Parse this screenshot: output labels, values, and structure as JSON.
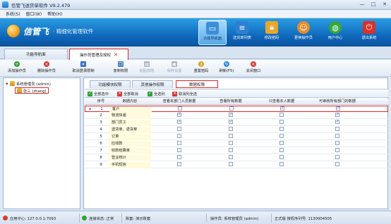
{
  "window": {
    "title": "信管飞送货单软件 V9.2.479",
    "controls": [
      "—",
      "□",
      "✕"
    ]
  },
  "menu": [
    "系统(S)",
    "窗口(W)",
    "帮助(H)"
  ],
  "banner": {
    "brand": "信管飞",
    "slogan": "· 精细化管理软件",
    "nav": [
      {
        "label": "功能导航面",
        "icon": "monitor-icon",
        "color": "#3b8fd9",
        "active": true
      },
      {
        "label": "送货单列表",
        "icon": "list-icon",
        "color": "#2f7fd0",
        "active": false
      },
      {
        "label": "修改密码",
        "icon": "lock-icon",
        "color": "#e9a82b",
        "active": false
      },
      {
        "label": "更换操作员",
        "icon": "user-icon",
        "color": "#e58b2b",
        "active": false
      },
      {
        "label": "用户中心",
        "icon": "globe-icon",
        "color": "#35a83c",
        "active": false
      },
      {
        "label": "退出系统",
        "icon": "power-icon",
        "color": "#d8322b",
        "active": false
      }
    ]
  },
  "pagetabs": [
    {
      "label": "功能导航面",
      "active": false
    },
    {
      "label": "操作员管理及授权",
      "active": true
    }
  ],
  "toolbar": [
    {
      "label": "添加操作员",
      "icon": "add-user-icon",
      "color": "#36a13a",
      "disabled": false
    },
    {
      "label": "删除操作员",
      "icon": "delete-user-icon",
      "color": "#d83a2f",
      "disabled": false
    },
    {
      "label": "取消登录限制",
      "icon": "unlock-icon",
      "color": "#3a6fc9",
      "disabled": false
    },
    {
      "label": "复制权限",
      "icon": "copy-icon",
      "color": "#4c7fc8",
      "disabled": false
    },
    {
      "label": "粘贴权限",
      "icon": "paste-icon",
      "color": "#a9b4c2",
      "disabled": true
    },
    {
      "label": "保存设置",
      "icon": "save-icon",
      "color": "#a9b4c2",
      "disabled": true
    },
    {
      "label": "重置密码",
      "icon": "key-icon",
      "color": "#d9a22a",
      "disabled": false
    },
    {
      "label": "刷新(F5)",
      "icon": "refresh-icon",
      "color": "#2f8ad6",
      "disabled": false
    },
    {
      "label": "关闭窗口",
      "icon": "close-icon",
      "color": "#d83a2f",
      "disabled": false
    }
  ],
  "tree": {
    "root": "系统管理员 (admin)",
    "selected": "张三 (zhang)"
  },
  "subtabs": [
    {
      "label": "功能模块权限",
      "active": false
    },
    {
      "label": "其他操作权限",
      "active": false
    },
    {
      "label": "数据权限",
      "active": true
    }
  ],
  "subbar": [
    {
      "label": "全部选中",
      "icon": "check-all-icon",
      "color": "#2fa33a"
    },
    {
      "label": "全部取消",
      "icon": "uncheck-all-icon",
      "color": "#d83a2f"
    },
    {
      "label": "全选列",
      "icon": "check-column-icon",
      "color": "#2fa33a"
    },
    {
      "label": "取消列全选",
      "icon": "uncheck-column-icon",
      "color": "#d83a2f"
    }
  ],
  "table": {
    "headers": [
      "序号",
      "数据内容",
      "查看本部门人员数据",
      "查看所有数据",
      "只查看本人数据",
      "可审核所有部门的数据"
    ],
    "rows": [
      {
        "no": "1",
        "name": "客户",
        "checks": [
          false,
          false,
          true,
          true
        ],
        "current": true,
        "selected": true
      },
      {
        "no": "2",
        "name": "物流快递",
        "checks": [
          true,
          true,
          false,
          true
        ],
        "current": false,
        "selected": false
      },
      {
        "no": "3",
        "name": "部门员工",
        "checks": [
          true,
          true,
          false,
          true
        ],
        "current": false,
        "selected": false
      },
      {
        "no": "4",
        "name": "送货单、退货单",
        "checks": [
          false,
          false,
          false,
          false
        ],
        "current": false,
        "selected": false
      },
      {
        "no": "5",
        "name": "订单",
        "checks": [
          false,
          false,
          false,
          false
        ],
        "current": false,
        "selected": false
      },
      {
        "no": "6",
        "name": "应收款",
        "checks": [
          false,
          false,
          false,
          false
        ],
        "current": false,
        "selected": false
      },
      {
        "no": "7",
        "name": "收款结算单",
        "checks": [
          false,
          false,
          false,
          false
        ],
        "current": false,
        "selected": false
      },
      {
        "no": "8",
        "name": "营业统计",
        "checks": [
          false,
          false,
          false,
          false
        ],
        "current": false,
        "selected": false
      },
      {
        "no": "9",
        "name": "手机短信",
        "checks": [
          false,
          false,
          false,
          false
        ],
        "current": false,
        "selected": false
      }
    ]
  },
  "status": {
    "center": "应用中心: 127.0.0.1:7093",
    "connection": "连接状态: 正常",
    "account": "账套: 演示账套",
    "operator": "操作员: 系统管理员 (admin)",
    "license": "正式版 授权序列号: 1130904505"
  }
}
